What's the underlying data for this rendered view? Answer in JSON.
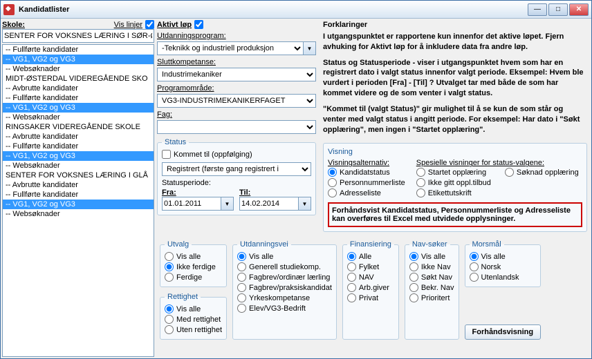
{
  "window": {
    "title": "Kandidatlister"
  },
  "left": {
    "skole_label": "Skole:",
    "vis_linjer_label": "Vis linjer",
    "vis_linjer_checked": true,
    "skole_input": "SENTER FOR VOKSNES LÆRING I SØR-Ø",
    "items": [
      {
        "t": "-- Fullførte kandidater",
        "sel": false
      },
      {
        "t": "-- VG1, VG2 og VG3",
        "sel": true
      },
      {
        "t": "-- Websøknader",
        "sel": false
      },
      {
        "t": "MIDT-ØSTERDAL VIDEREGÅENDE SKO",
        "sel": false
      },
      {
        "t": "-- Avbrutte kandidater",
        "sel": false
      },
      {
        "t": "-- Fullførte kandidater",
        "sel": false
      },
      {
        "t": "-- VG1, VG2 og VG3",
        "sel": true
      },
      {
        "t": "-- Websøknader",
        "sel": false
      },
      {
        "t": "RINGSAKER VIDEREGÅENDE SKOLE",
        "sel": false
      },
      {
        "t": "-- Avbrutte kandidater",
        "sel": false
      },
      {
        "t": "-- Fullførte kandidater",
        "sel": false
      },
      {
        "t": "-- VG1, VG2 og VG3",
        "sel": true
      },
      {
        "t": "-- Websøknader",
        "sel": false
      },
      {
        "t": "SENTER FOR VOKSNES LÆRING I GLÅ",
        "sel": false
      },
      {
        "t": "-- Avbrutte kandidater",
        "sel": false
      },
      {
        "t": "-- Fullførte kandidater",
        "sel": false
      },
      {
        "t": "-- VG1, VG2 og VG3",
        "sel": true
      },
      {
        "t": "-- Websøknader",
        "sel": false
      }
    ]
  },
  "mid": {
    "aktivt_lop_label": "Aktivt løp",
    "aktivt_lop_checked": true,
    "utdprog_label": "Utdanningsprogram:",
    "utdprog_value": "-Teknikk og industriell produksjon",
    "sluttkomp_label": "Sluttkompetanse:",
    "sluttkomp_value": "Industrimekaniker",
    "programomrade_label": "Programområde:",
    "programomrade_value": "VG3-INDUSTRIMEKANIKERFAGET",
    "fag_label": "Fag:",
    "fag_value": "",
    "status_legend": "Status",
    "kommet_til_label": "Kommet til (oppfølging)",
    "kommet_til_checked": false,
    "status_select": "Registrert (første gang registrert i",
    "statusperiode_label": "Statusperiode:",
    "fra_label": "Fra:",
    "til_label": "Til:",
    "fra_value": "01.01.2011",
    "til_value": "14.02.2014"
  },
  "right": {
    "forklaring_h": "Forklaringer",
    "p1": "I utgangspunktet er rapportene kun innenfor det aktive løpet. Fjern avhuking for Aktivt løp for å inkludere data fra andre løp.",
    "p2": "Status og Statusperiode - viser i utgangspunktet hvem som har en registrert dato i valgt status innenfor valgt periode. Eksempel: Hvem ble vurdert i perioden [Fra] - [Til] ? Utvalget tar med både de som har kommet videre og de som venter i valgt status.",
    "p3": "\"Kommet til (valgt Status)\" gir mulighet til å se kun de som står og venter med valgt status i angitt periode. For eksempel: Har dato i \"Søkt opplæring\", men ingen i \"Startet opplæring\".",
    "visning_legend": "Visning",
    "visningsalt_label": "Visningsalternativ:",
    "spesielle_label": "Spesielle visninger for status-valgene:",
    "va": [
      "Kandidatstatus",
      "Personnummerliste",
      "Adresseliste"
    ],
    "va_selected": 0,
    "sp_left": [
      {
        "label": "Startet opplæring",
        "checked": false
      },
      {
        "label": "Ikke gitt oppl.tilbud",
        "checked": false
      },
      {
        "label": "Etikettutskrift",
        "checked": false
      }
    ],
    "sp_right": [
      {
        "label": "Søknad opplæring",
        "checked": false
      }
    ],
    "redbox": "Forhåndsvist Kandidatstatus, Personnummerliste og Adresseliste kan overføres til Excel med utvidede opplysninger."
  },
  "bottom": {
    "utvalg": {
      "legend": "Utvalg",
      "opts": [
        "Vis alle",
        "Ikke ferdige",
        "Ferdige"
      ],
      "sel": 1
    },
    "rettighet": {
      "legend": "Rettighet",
      "opts": [
        "Vis alle",
        "Med rettighet",
        "Uten rettighet"
      ],
      "sel": 0
    },
    "utdvei": {
      "legend": "Utdanningsvei",
      "opts": [
        "Vis alle",
        "Generell studiekomp.",
        "Fagbrev/ordinær lærling",
        "Fagbrev/praksiskandidat",
        "Yrkeskompetanse",
        "Elev/VG3-Bedrift"
      ],
      "sel": 0
    },
    "finans": {
      "legend": "Finansiering",
      "opts": [
        "Alle",
        "Fylket",
        "NAV",
        "Arb.giver",
        "Privat"
      ],
      "sel": 0
    },
    "navsoker": {
      "legend": "Nav-søker",
      "opts": [
        "Vis alle",
        "Ikke Nav",
        "Søkt Nav",
        "Bekr. Nav",
        "Prioritert"
      ],
      "sel": 0
    },
    "morsmal": {
      "legend": "Morsmål",
      "opts": [
        "Vis alle",
        "Norsk",
        "Utenlandsk"
      ],
      "sel": 0
    },
    "forhandsvisning": "Forhåndsvisning"
  }
}
